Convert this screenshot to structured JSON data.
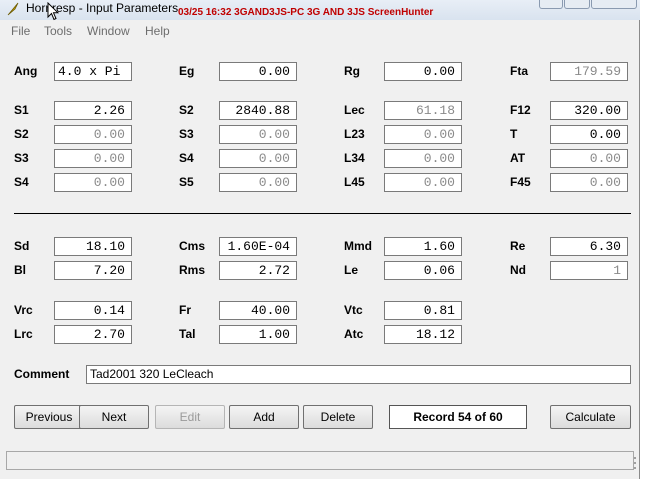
{
  "window": {
    "title": "Hornresp - Input Parameters",
    "overlay": "03/25  16:32  3GAND3JS-PC  3G AND 3JS  ScreenHunter"
  },
  "menu": [
    "File",
    "Tools",
    "Window",
    "Help"
  ],
  "groups": {
    "row1": [
      {
        "label": "Ang",
        "value": "4.0 x Pi",
        "disabled": false
      },
      {
        "label": "Eg",
        "value": "0.00",
        "disabled": false
      },
      {
        "label": "Rg",
        "value": "0.00",
        "disabled": false
      },
      {
        "label": "Fta",
        "value": "179.59",
        "disabled": true
      }
    ],
    "row2": [
      {
        "label": "S1",
        "value": "2.26",
        "disabled": false
      },
      {
        "label": "S2",
        "value": "2840.88",
        "disabled": false
      },
      {
        "label": "Lec",
        "value": "61.18",
        "disabled": true
      },
      {
        "label": "F12",
        "value": "320.00",
        "disabled": false
      }
    ],
    "row3": [
      {
        "label": "S2",
        "value": "0.00",
        "disabled": true
      },
      {
        "label": "S3",
        "value": "0.00",
        "disabled": true
      },
      {
        "label": "L23",
        "value": "0.00",
        "disabled": true
      },
      {
        "label": "T",
        "value": "0.00",
        "disabled": false
      }
    ],
    "row4": [
      {
        "label": "S3",
        "value": "0.00",
        "disabled": true
      },
      {
        "label": "S4",
        "value": "0.00",
        "disabled": true
      },
      {
        "label": "L34",
        "value": "0.00",
        "disabled": true
      },
      {
        "label": "AT",
        "value": "0.00",
        "disabled": true
      }
    ],
    "row5": [
      {
        "label": "S4",
        "value": "0.00",
        "disabled": true
      },
      {
        "label": "S5",
        "value": "0.00",
        "disabled": true
      },
      {
        "label": "L45",
        "value": "0.00",
        "disabled": true
      },
      {
        "label": "F45",
        "value": "0.00",
        "disabled": true
      }
    ],
    "row6": [
      {
        "label": "Sd",
        "value": "18.10",
        "disabled": false
      },
      {
        "label": "Cms",
        "value": "1.60E-04",
        "disabled": false
      },
      {
        "label": "Mmd",
        "value": "1.60",
        "disabled": false
      },
      {
        "label": "Re",
        "value": "6.30",
        "disabled": false
      }
    ],
    "row7": [
      {
        "label": "Bl",
        "value": "7.20",
        "disabled": false
      },
      {
        "label": "Rms",
        "value": "2.72",
        "disabled": false
      },
      {
        "label": "Le",
        "value": "0.06",
        "disabled": false
      },
      {
        "label": "Nd",
        "value": "1",
        "disabled": true
      }
    ],
    "row8": [
      {
        "label": "Vrc",
        "value": "0.14",
        "disabled": false
      },
      {
        "label": "Fr",
        "value": "40.00",
        "disabled": false
      },
      {
        "label": "Vtc",
        "value": "0.81",
        "disabled": false
      }
    ],
    "row9": [
      {
        "label": "Lrc",
        "value": "2.70",
        "disabled": false
      },
      {
        "label": "Tal",
        "value": "1.00",
        "disabled": false
      },
      {
        "label": "Atc",
        "value": "18.12",
        "disabled": false
      }
    ]
  },
  "comment": {
    "label": "Comment",
    "value": "Tad2001 320 LeCleach"
  },
  "buttons": {
    "previous": "Previous",
    "next": "Next",
    "edit": "Edit",
    "add": "Add",
    "delete": "Delete",
    "calculate": "Calculate"
  },
  "record": "Record 54 of 60"
}
